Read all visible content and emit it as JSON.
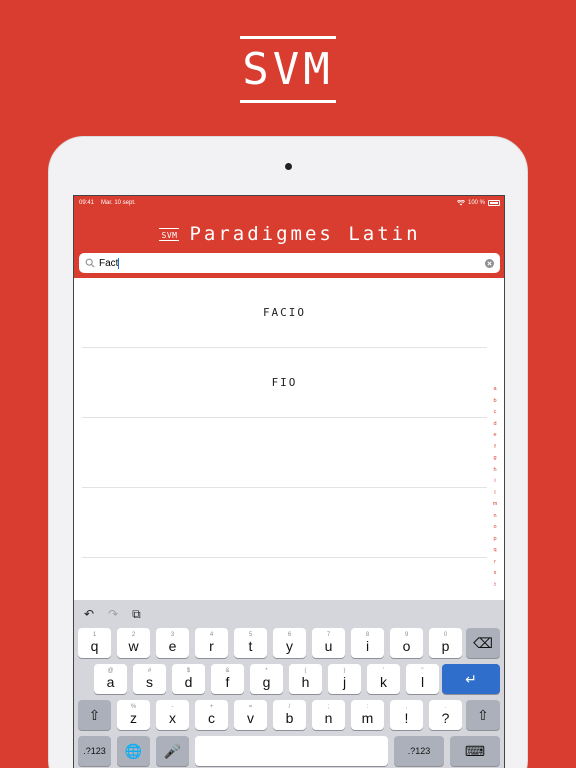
{
  "brand": {
    "logo_text": "SVM"
  },
  "status_bar": {
    "time": "09:41",
    "date": "Mar. 10 sept.",
    "battery": "100 %"
  },
  "header": {
    "mini_logo": "SVM",
    "title": "Paradigmes Latin"
  },
  "search": {
    "value": "Fact",
    "icon": "search-icon",
    "clear_icon": "clear-icon"
  },
  "results": [
    {
      "label": "FACIO"
    },
    {
      "label": "FIO"
    },
    {
      "label": ""
    },
    {
      "label": ""
    }
  ],
  "alpha_index": [
    "a",
    "b",
    "c",
    "d",
    "e",
    "f",
    "g",
    "h",
    "i",
    "l",
    "m",
    "n",
    "o",
    "p",
    "q",
    "r",
    "s",
    "t"
  ],
  "keyboard": {
    "toolbar": {
      "undo": "↶",
      "redo": "↷",
      "paste": "⧉"
    },
    "row1": [
      {
        "ch": "q",
        "hint": "1"
      },
      {
        "ch": "w",
        "hint": "2"
      },
      {
        "ch": "e",
        "hint": "3"
      },
      {
        "ch": "r",
        "hint": "4"
      },
      {
        "ch": "t",
        "hint": "5"
      },
      {
        "ch": "y",
        "hint": "6"
      },
      {
        "ch": "u",
        "hint": "7"
      },
      {
        "ch": "i",
        "hint": "8"
      },
      {
        "ch": "o",
        "hint": "9"
      },
      {
        "ch": "p",
        "hint": "0"
      }
    ],
    "row2": [
      {
        "ch": "a",
        "hint": "@"
      },
      {
        "ch": "s",
        "hint": "#"
      },
      {
        "ch": "d",
        "hint": "$"
      },
      {
        "ch": "f",
        "hint": "&"
      },
      {
        "ch": "g",
        "hint": "*"
      },
      {
        "ch": "h",
        "hint": "("
      },
      {
        "ch": "j",
        "hint": ")"
      },
      {
        "ch": "k",
        "hint": "'"
      },
      {
        "ch": "l",
        "hint": "\""
      }
    ],
    "row3": [
      {
        "ch": "z",
        "hint": "%"
      },
      {
        "ch": "x",
        "hint": "-"
      },
      {
        "ch": "c",
        "hint": "+"
      },
      {
        "ch": "v",
        "hint": "="
      },
      {
        "ch": "b",
        "hint": "/"
      },
      {
        "ch": "n",
        "hint": ";"
      },
      {
        "ch": "m",
        "hint": ":"
      },
      {
        "ch": "!",
        "hint": ","
      },
      {
        "ch": "?",
        "hint": "."
      }
    ],
    "backspace": "⌫",
    "return": "↵",
    "shift": "⇧",
    "numbers_left": ".?123",
    "numbers_right": ".?123",
    "globe": "🌐",
    "mic": "🎤",
    "hide": "⌨",
    "accent_color": "#d83d30"
  }
}
